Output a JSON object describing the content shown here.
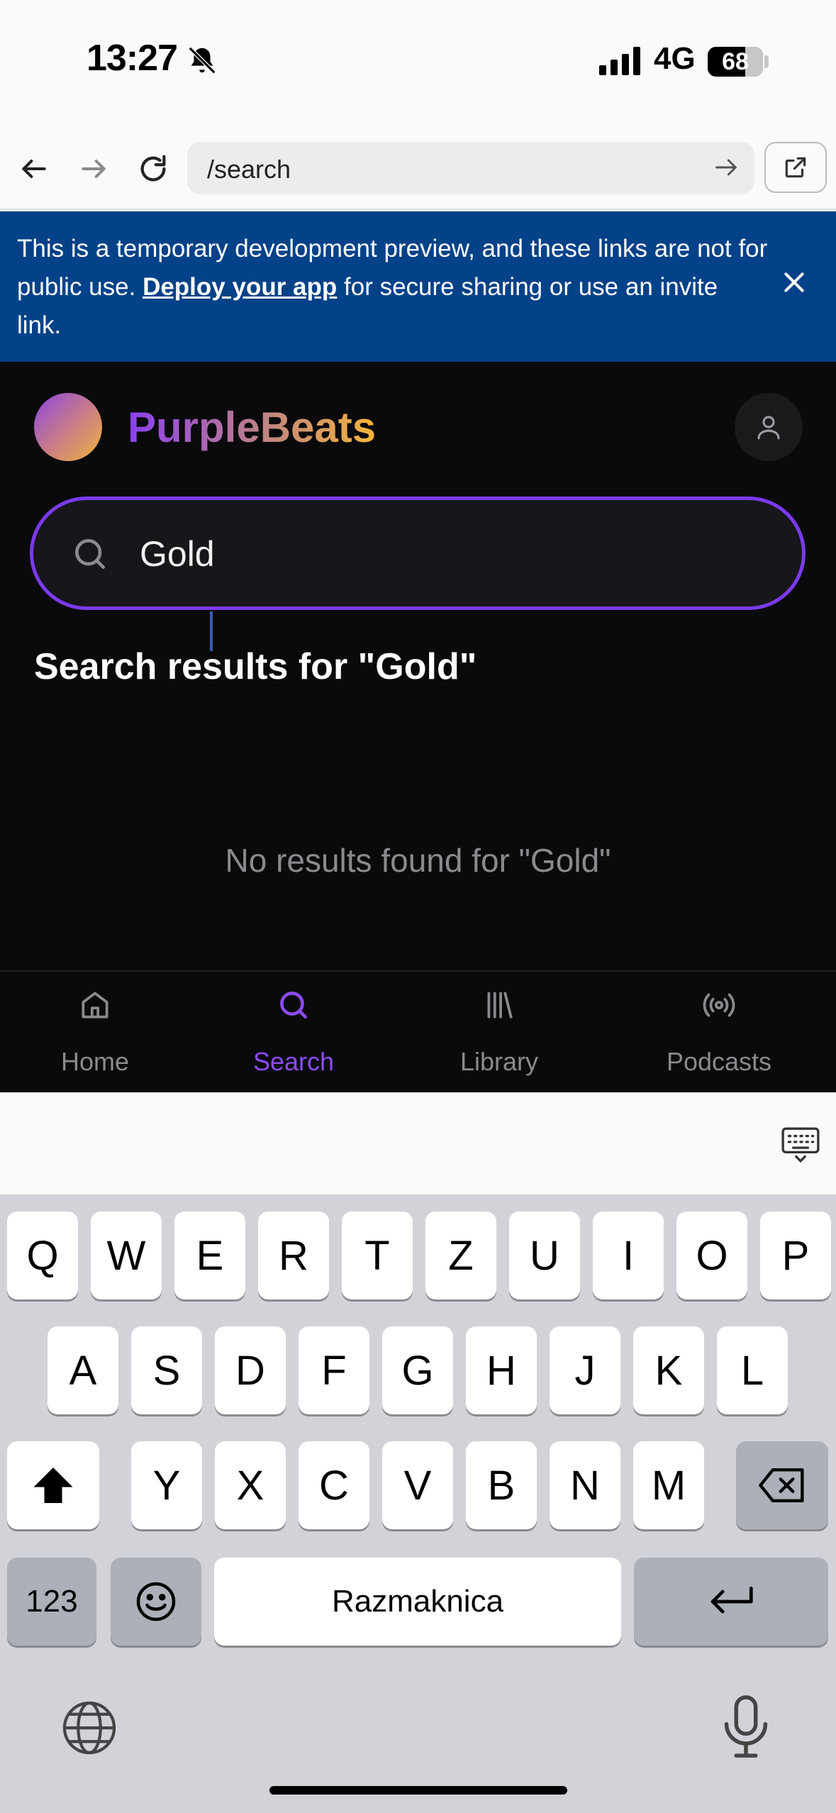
{
  "status": {
    "time": "13:27",
    "network": "4G",
    "battery": "68",
    "battery_level": 0.68
  },
  "browser": {
    "url": "/search"
  },
  "banner": {
    "text_before": "This is a temporary development preview, and these links are not for public use. ",
    "link": "Deploy your app",
    "text_after": " for secure sharing or use an invite link."
  },
  "app": {
    "brand": "PurpleBeats",
    "search_value": "Gold",
    "results_title": "Search results for \"Gold\"",
    "no_results": "No results found for \"Gold\""
  },
  "nav": {
    "items": [
      {
        "label": "Home",
        "icon": "home-icon"
      },
      {
        "label": "Search",
        "icon": "search-icon",
        "active": true
      },
      {
        "label": "Library",
        "icon": "library-icon"
      },
      {
        "label": "Podcasts",
        "icon": "podcast-icon"
      }
    ]
  },
  "keyboard": {
    "row1": [
      "Q",
      "W",
      "E",
      "R",
      "T",
      "Z",
      "U",
      "I",
      "O",
      "P"
    ],
    "row2": [
      "A",
      "S",
      "D",
      "F",
      "G",
      "H",
      "J",
      "K",
      "L"
    ],
    "row3": [
      "Y",
      "X",
      "C",
      "V",
      "B",
      "N",
      "M"
    ],
    "numbers_key": "123",
    "space_key": "Razmaknica"
  },
  "colors": {
    "accent": "#7c3aed",
    "banner": "#034288",
    "app_bg": "#0a0a0c"
  }
}
